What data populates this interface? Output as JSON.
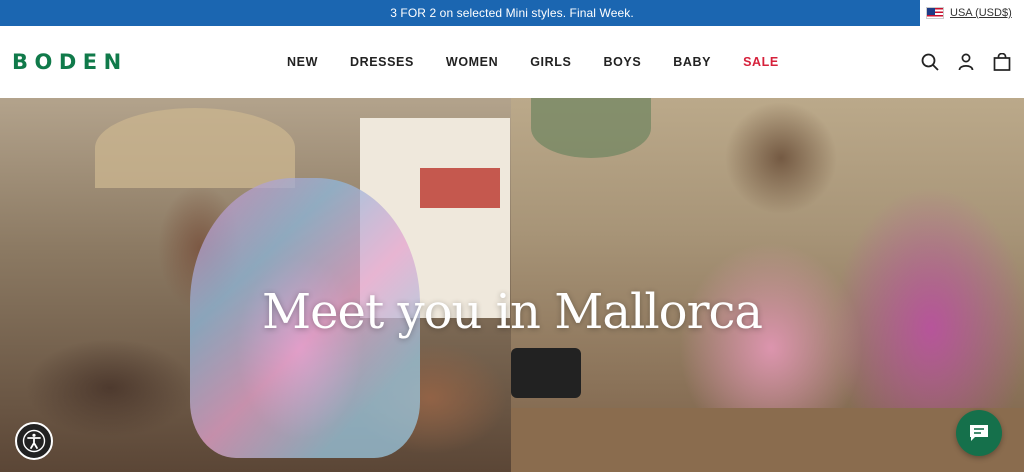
{
  "promo": {
    "text": "3 FOR 2 on selected Mini styles. Final Week."
  },
  "region": {
    "label": "USA (USD$)",
    "flag_icon": "us-flag-icon"
  },
  "header": {
    "logo": "BODEN",
    "nav": [
      {
        "label": "NEW"
      },
      {
        "label": "DRESSES"
      },
      {
        "label": "WOMEN"
      },
      {
        "label": "GIRLS"
      },
      {
        "label": "BOYS"
      },
      {
        "label": "BABY"
      },
      {
        "label": "SALE"
      }
    ],
    "icons": [
      "search-icon",
      "account-icon",
      "bag-icon"
    ]
  },
  "hero": {
    "title": "Meet you in Mallorca"
  },
  "colors": {
    "promo_bg": "#1b66b1",
    "brand_green": "#107a4a",
    "sale_red": "#d6213b",
    "chat_green": "#15704b"
  }
}
